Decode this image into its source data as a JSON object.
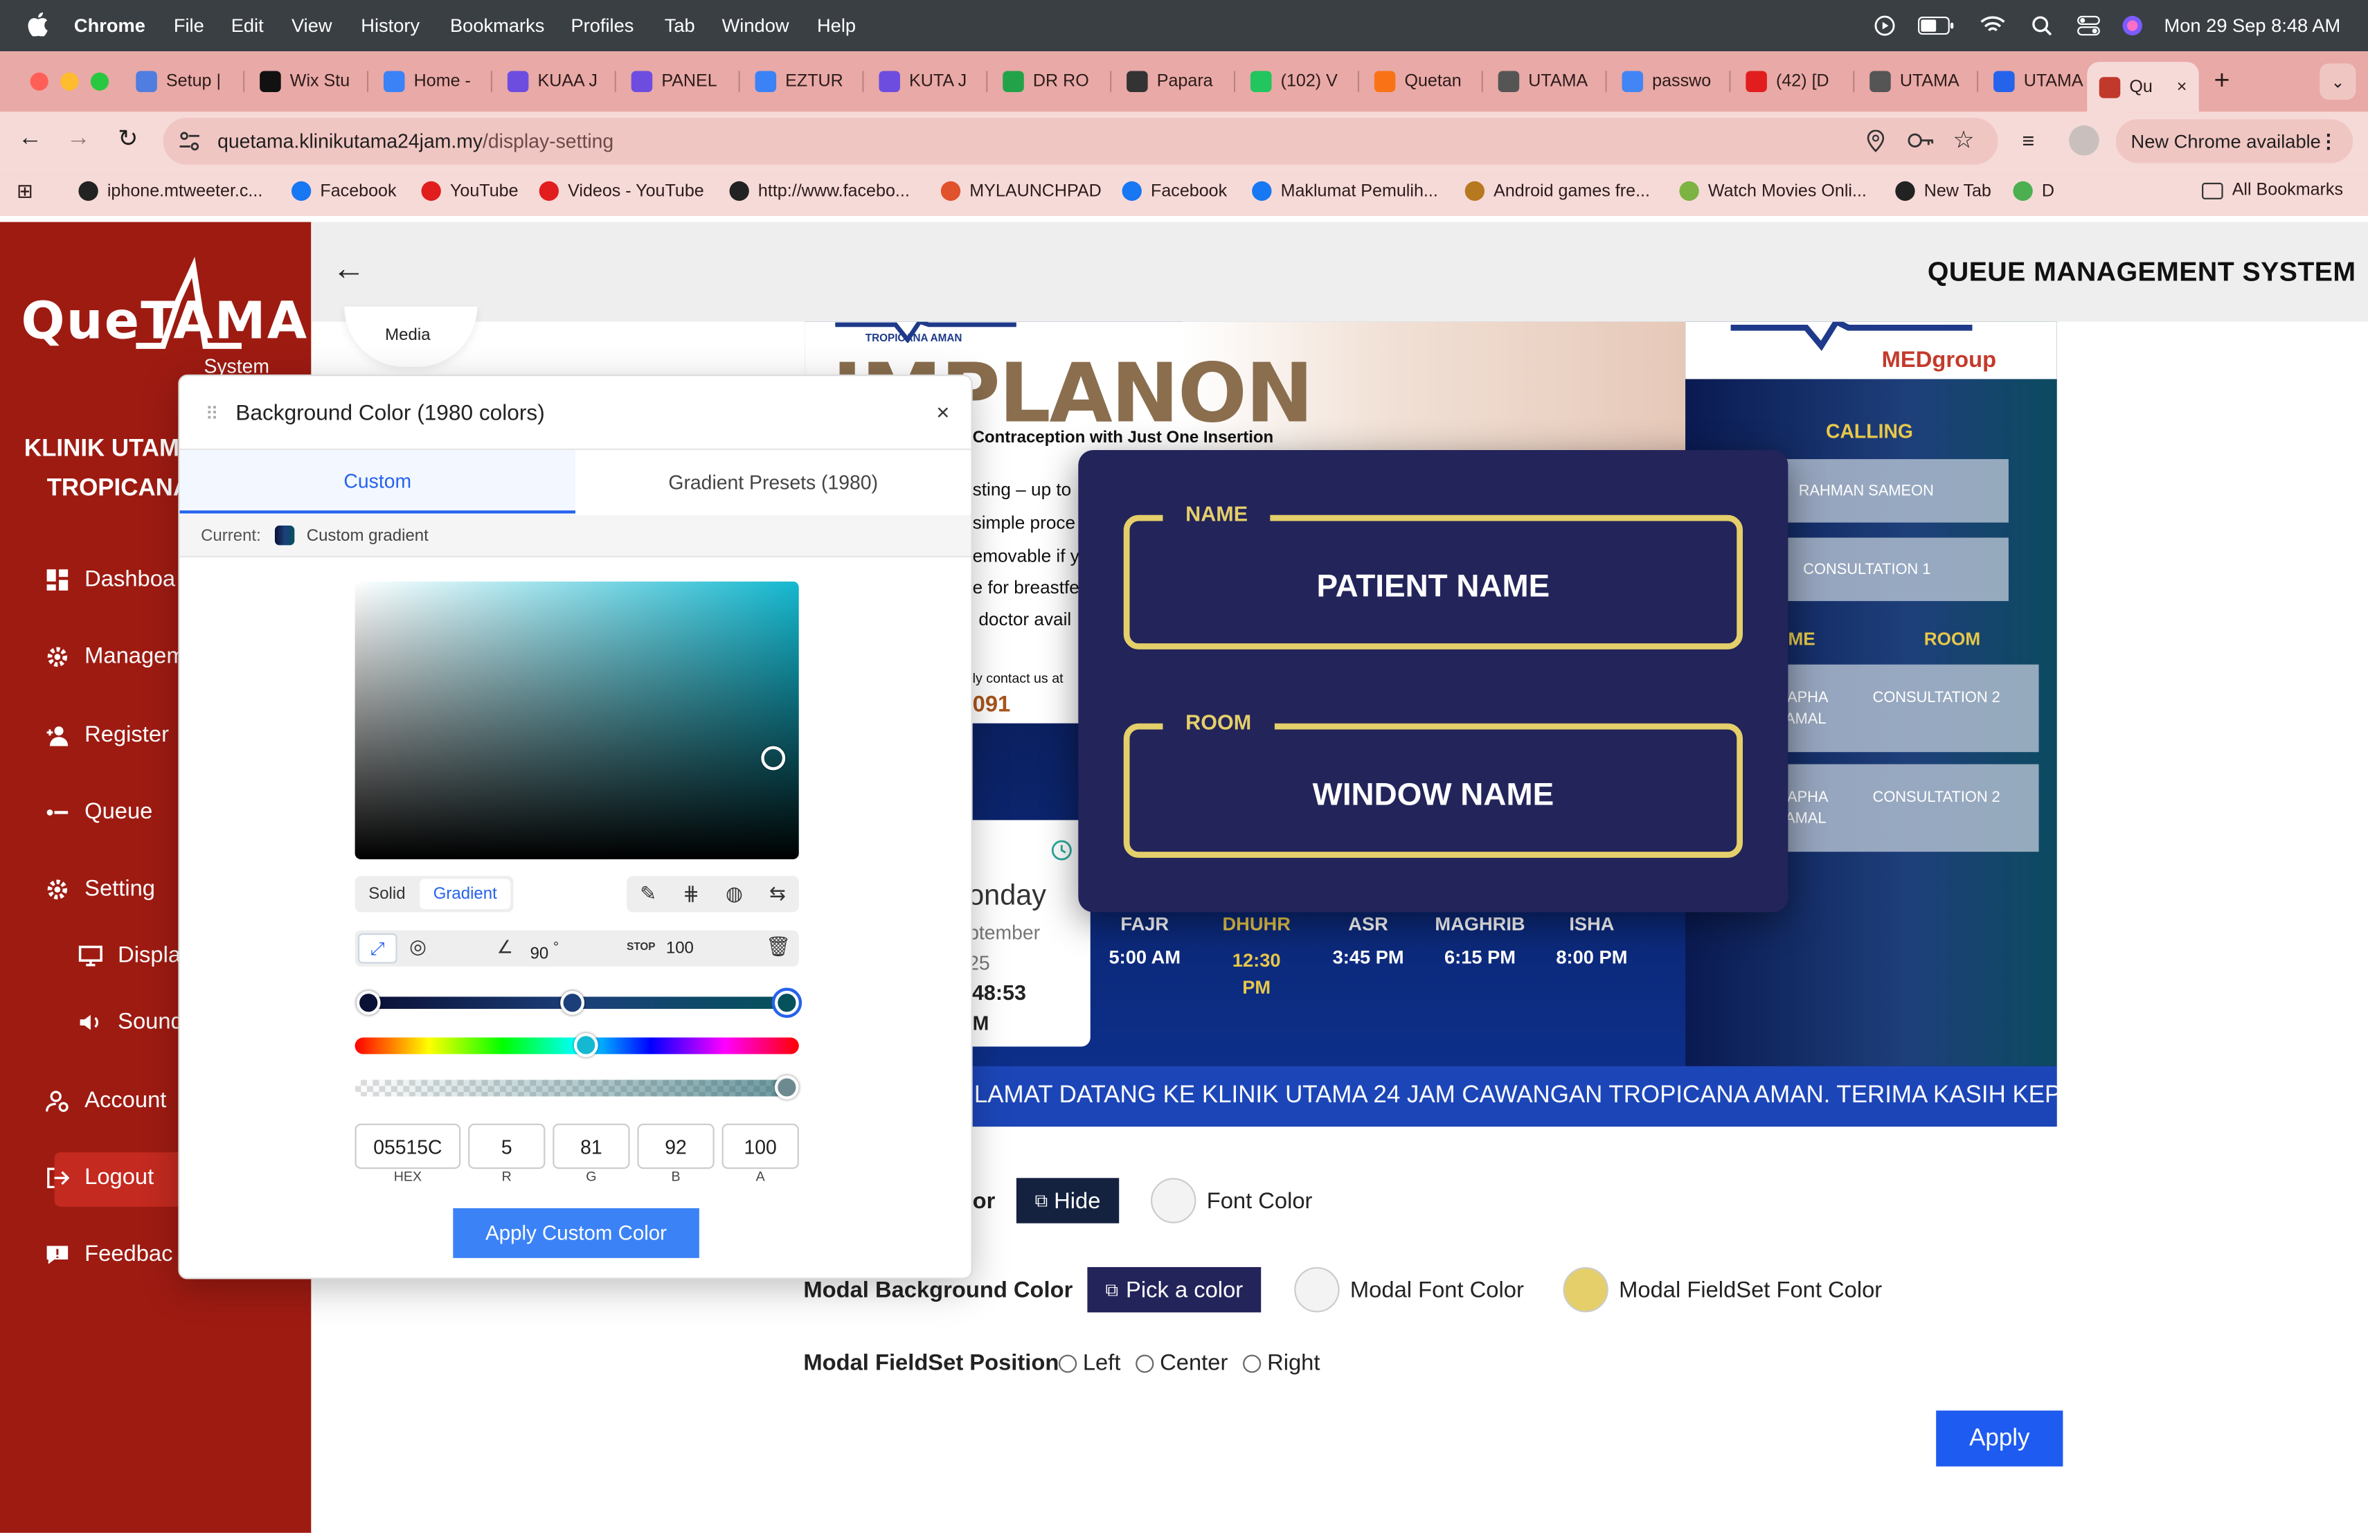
{
  "menubar": {
    "app": "Chrome",
    "items": [
      "File",
      "Edit",
      "View",
      "History",
      "Bookmarks",
      "Profiles",
      "Tab",
      "Window",
      "Help"
    ],
    "datetime": "Mon 29 Sep  8:48 AM"
  },
  "tabs": [
    {
      "label": "Setup |",
      "color": "#4f7de0"
    },
    {
      "label": "Wix Stu",
      "color": "#111111"
    },
    {
      "label": "Home -",
      "color": "#3b82f6"
    },
    {
      "label": "KUAA J",
      "color": "#6d4de0"
    },
    {
      "label": "PANEL",
      "color": "#6d4de0"
    },
    {
      "label": "EZTUR",
      "color": "#3b82f6"
    },
    {
      "label": "KUTA J",
      "color": "#6d4de0"
    },
    {
      "label": "DR RO",
      "color": "#22a34a"
    },
    {
      "label": "Papara",
      "color": "#333333"
    },
    {
      "label": "(102) V",
      "color": "#22c55e"
    },
    {
      "label": "Quetan",
      "color": "#f97316"
    },
    {
      "label": "UTAMA",
      "color": "#555555"
    },
    {
      "label": "passwo",
      "color": "#4285f4"
    },
    {
      "label": "(42) [D",
      "color": "#e11d1d"
    },
    {
      "label": "UTAMA",
      "color": "#555555"
    },
    {
      "label": "UTAMA",
      "color": "#2563eb"
    },
    {
      "label": "Qu",
      "color": "#c0392b"
    }
  ],
  "address": {
    "url_domain": "quetama.klinikutama24jam.my",
    "url_path": "/display-setting",
    "update_label": "New Chrome available"
  },
  "bookmarks": [
    {
      "label": "iphone.mtweeter.c...",
      "color": "#222"
    },
    {
      "label": "Facebook",
      "color": "#1877f2"
    },
    {
      "label": "YouTube",
      "color": "#e11d1d"
    },
    {
      "label": "Videos - YouTube",
      "color": "#e11d1d"
    },
    {
      "label": "http://www.facebo...",
      "color": "#222"
    },
    {
      "label": "MYLAUNCHPAD",
      "color": "#e0522b"
    },
    {
      "label": "Facebook",
      "color": "#1877f2"
    },
    {
      "label": "Maklumat Pemulih...",
      "color": "#1877f2"
    },
    {
      "label": "Android games fre...",
      "color": "#b7791f"
    },
    {
      "label": "Watch Movies Onli...",
      "color": "#7cb342"
    },
    {
      "label": "New Tab",
      "color": "#222"
    },
    {
      "label": "D",
      "color": "#4caf50"
    }
  ],
  "all_bookmarks": "All Bookmarks",
  "app": {
    "logo": "QueTAMA",
    "logo_sub": "System",
    "clinic_line1": "KLINIK UTAM",
    "clinic_line2": "TROPICANA",
    "header_title": "QUEUE MANAGEMENT SYSTEM",
    "nav": [
      {
        "label": "Dashboa",
        "icon": "dashboard-icon"
      },
      {
        "label": "Managem",
        "icon": "gear-icon"
      },
      {
        "label": "Register",
        "icon": "add-user-icon"
      },
      {
        "label": "Queue",
        "icon": "queue-icon"
      },
      {
        "label": "Setting",
        "icon": "gear-icon"
      },
      {
        "label": "Displa",
        "icon": "monitor-icon"
      },
      {
        "label": "Sound",
        "icon": "speaker-icon"
      },
      {
        "label": "Account",
        "icon": "user-gear-icon"
      },
      {
        "label": "Logout",
        "icon": "logout-icon"
      },
      {
        "label": "Feedbac",
        "icon": "feedback-icon"
      }
    ],
    "media_label": "Media"
  },
  "preview": {
    "ad_brand": "TROPICANA AMAN",
    "ad_title": "IMPLANON",
    "ad_subtitle": "Contraception with Just One Insertion",
    "ad_lines": [
      "sting – up to",
      "simple proce",
      "emovable if y",
      "e for breastfe",
      "doctor avail"
    ],
    "ad_contact": "ly contact us at",
    "ad_phone": "091",
    "medgroup": "MEDgroup",
    "calling": "CALLING",
    "calling_name": "RAHMAN SAMEON",
    "calling_room": "CONSULTATION 1",
    "col_name": "ME",
    "col_room": "ROOM",
    "rows": [
      {
        "name1": "TAPHA",
        "name2": "AMAL",
        "room": "CONSULTATION 2"
      },
      {
        "name1": "TAPHA",
        "name2": "AMAL",
        "room": "CONSULTATION 2"
      }
    ],
    "modal_name_legend": "NAME",
    "modal_name_value": "PATIENT NAME",
    "modal_room_legend": "ROOM",
    "modal_room_value": "WINDOW NAME",
    "day": "onday",
    "month": "ptember",
    "year": "25",
    "time": ":48:53",
    "ampm": "M",
    "prayers": [
      {
        "name": "FAJR",
        "time": "5:00 AM"
      },
      {
        "name": "DHUHR",
        "time": "12:30 PM"
      },
      {
        "name": "ASR",
        "time": "3:45 PM"
      },
      {
        "name": "MAGHRIB",
        "time": "6:15 PM"
      },
      {
        "name": "ISHA",
        "time": "8:00 PM"
      }
    ],
    "ticker": "LAMAT DATANG KE KLINIK UTAMA 24 JAM CAWANGAN TROPICANA AMAN. TERIMA KASIH KEP"
  },
  "settings": {
    "partial_label": "or",
    "hide_btn": "Hide",
    "font_color": "Font Color",
    "modal_bg_label": "Modal Background Color",
    "pick_btn": "Pick a color",
    "modal_font_color": "Modal Font Color",
    "modal_fieldset_font_color": "Modal FieldSet Font Color",
    "fieldset_position_label": "Modal FieldSet Position",
    "pos_left": "Left",
    "pos_center": "Center",
    "pos_right": "Right",
    "apply": "Apply",
    "fieldset_swatch": "#e4cf6a"
  },
  "picker": {
    "title": "Background Color (1980 colors)",
    "tab_custom": "Custom",
    "tab_presets": "Gradient Presets (1980)",
    "current_label": "Current:",
    "current_value": "Custom gradient",
    "mode_solid": "Solid",
    "mode_gradient": "Gradient",
    "angle": "90",
    "angle_unit": "°",
    "stop_label": "STOP",
    "stop_value": "100",
    "hex": "05515C",
    "r": "5",
    "g": "81",
    "b": "92",
    "a": "100",
    "hex_label": "HEX",
    "r_label": "R",
    "g_label": "G",
    "b_label": "B",
    "a_label": "A",
    "apply_btn": "Apply Custom Color",
    "gradient_stops": [
      "#0b1035",
      "#1c3f7a",
      "#05515c"
    ]
  }
}
